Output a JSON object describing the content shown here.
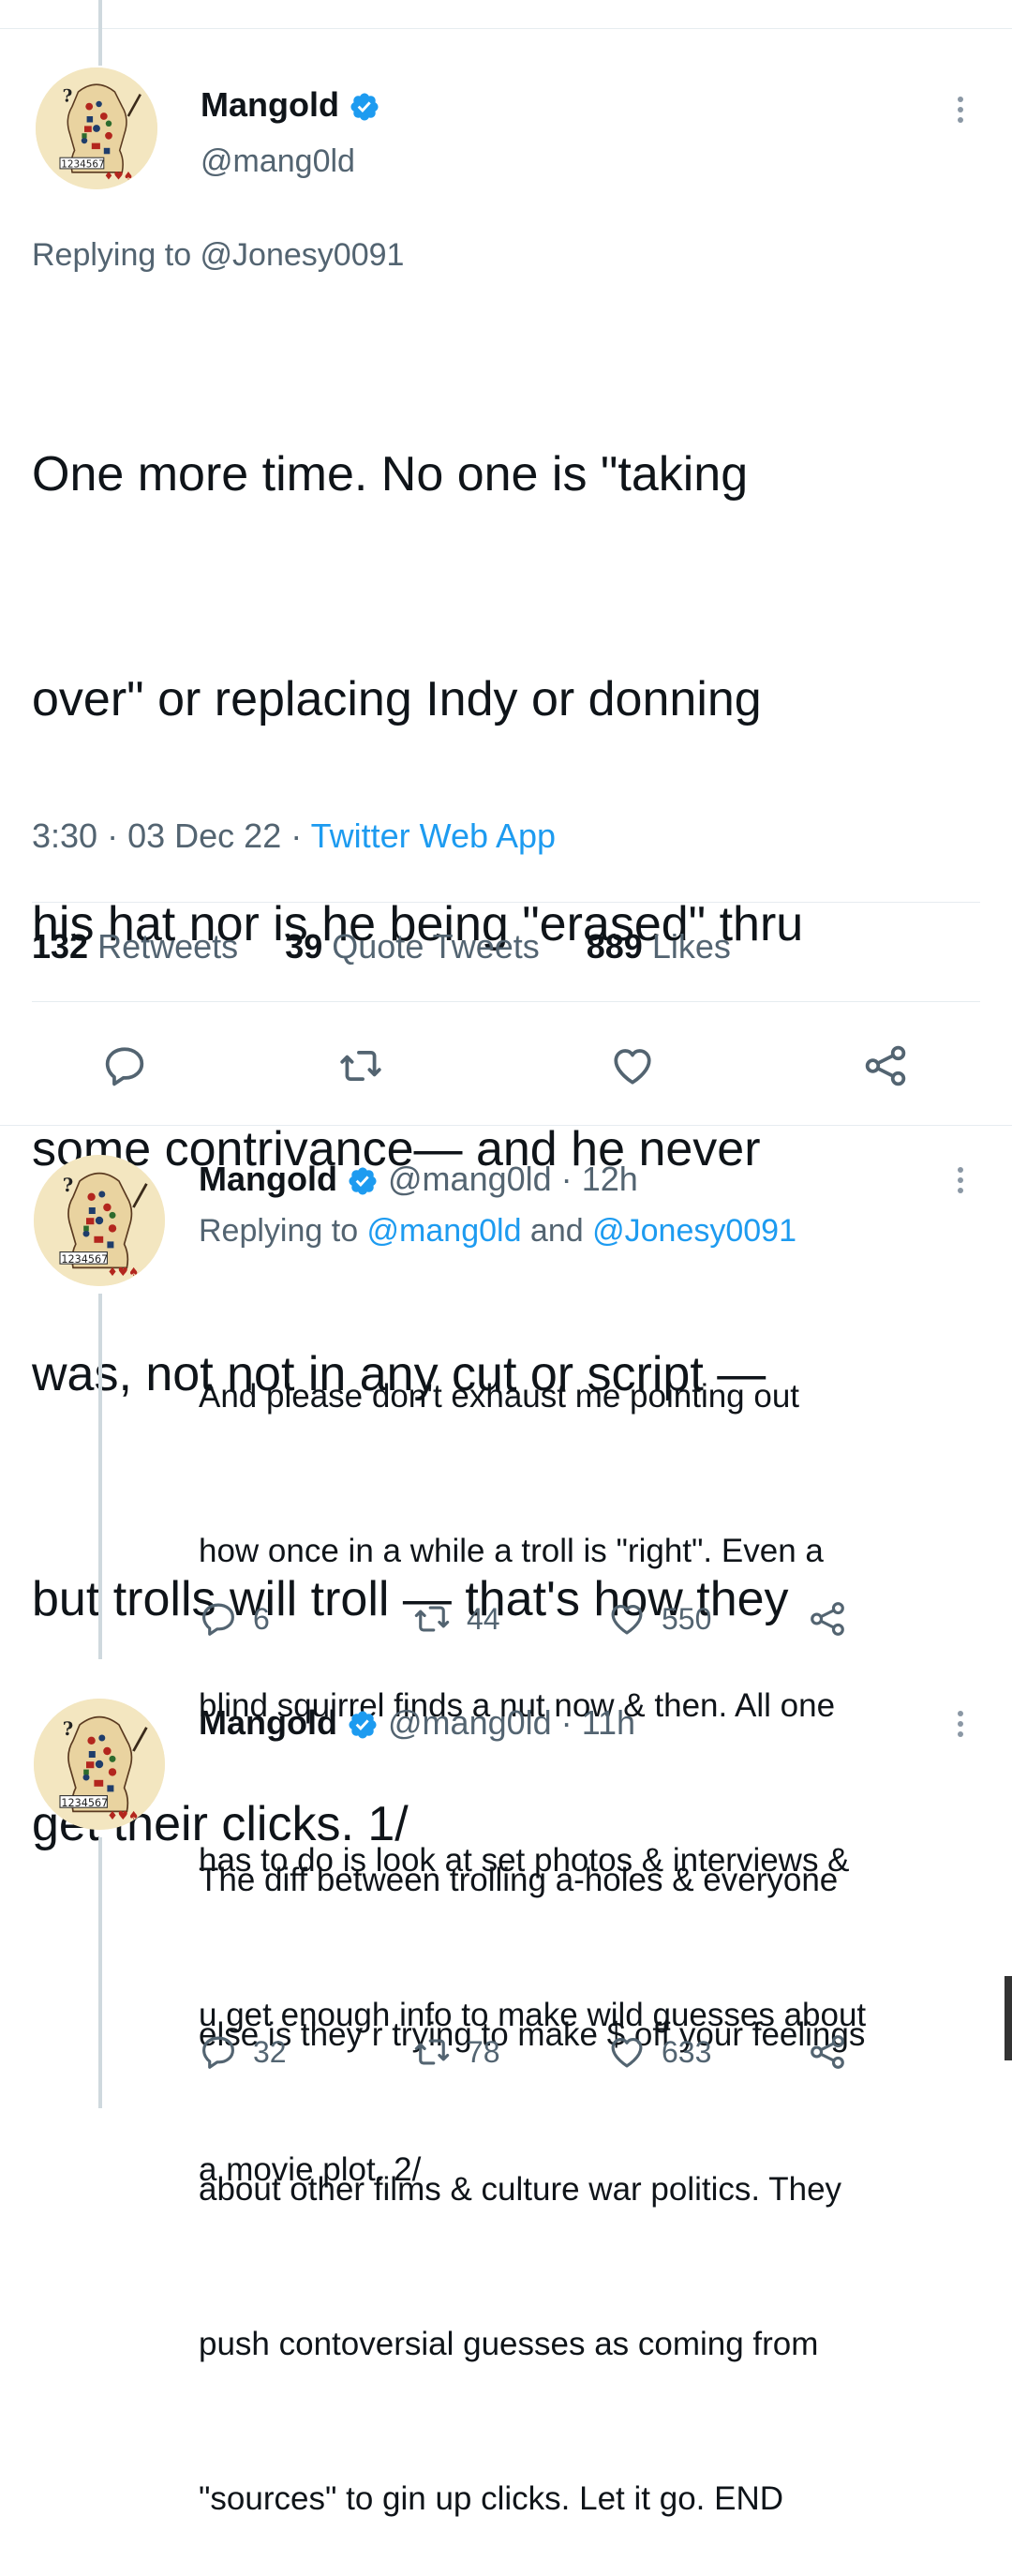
{
  "main_tweet": {
    "author_name": "Mangold",
    "author_handle": "@mang0ld",
    "replying_to_prefix": "Replying to ",
    "replying_to_handle": "@Jonesy0091",
    "text_lines": [
      "One more time. No one is \"taking",
      "over\" or replacing Indy or donning",
      "his hat nor is he being \"erased\" thru",
      "some contrivance— and he never",
      "was, not not in any cut or script —",
      "but trolls will troll — that's how they",
      "get their clicks. 1/"
    ],
    "time": "3:30",
    "date": "03 Dec 22",
    "source": "Twitter Web App",
    "separator": "·",
    "retweets_count": "132",
    "retweets_label": "Retweets",
    "quotes_count": "39",
    "quotes_label": "Quote Tweets",
    "likes_count": "889",
    "likes_label": "Likes"
  },
  "reply_1": {
    "author_name": "Mangold",
    "author_handle": "@mang0ld",
    "age": "12h",
    "separator": "·",
    "replying_to_prefix": "Replying to ",
    "replying_to_handle_1": "@mang0ld",
    "replying_to_and": " and ",
    "replying_to_handle_2": "@Jonesy0091",
    "text_lines": [
      "And please don't exhaust me pointing out",
      "how once in a while a troll is \"right\". Even a",
      "blind squirrel finds a nut now & then. All one",
      "has to do is look at set photos & interviews &",
      "u get enough info to make wild guesses about",
      "a movie plot. 2/"
    ],
    "replies": "6",
    "retweets": "44",
    "likes": "550"
  },
  "reply_2": {
    "author_name": "Mangold",
    "author_handle": "@mang0ld",
    "age": "11h",
    "separator": "·",
    "text_lines": [
      "The diff between trolling a-holes & everyone",
      "else is they r trying to make $ off your feelings",
      "about other films & culture war politics. They",
      "push contoversial guesses as coming from",
      "\"sources\" to gin up clicks. Let it go. END"
    ],
    "replies": "32",
    "retweets": "78",
    "likes": "633"
  },
  "icons": {
    "verified": "verified-badge-icon",
    "more": "more-options-icon",
    "reply": "reply-icon",
    "retweet": "retweet-icon",
    "like": "heart-icon",
    "share": "share-icon"
  },
  "colors": {
    "accent": "#1d9bf0",
    "text": "#0f1419",
    "muted": "#536471",
    "divider": "#e6ecf0"
  }
}
